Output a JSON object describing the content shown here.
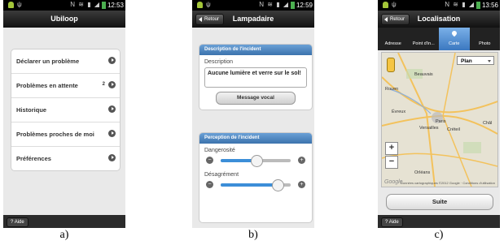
{
  "screen_a": {
    "status_time": "12:53",
    "title": "Ubiloop",
    "menu": [
      {
        "label": "Déclarer un problème",
        "count": ""
      },
      {
        "label": "Problèmes en attente",
        "count": "2"
      },
      {
        "label": "Historique",
        "count": ""
      },
      {
        "label": "Problèmes proches de moi",
        "count": ""
      },
      {
        "label": "Préférences",
        "count": ""
      }
    ],
    "help_label": "Aide",
    "caption": "a)"
  },
  "screen_b": {
    "status_time": "12:59",
    "back_label": "Retour",
    "title": "Lampadaire",
    "section1_header": "Description de l'incident",
    "description_label": "Description",
    "description_value": "Aucune lumière et verre sur le sol!",
    "voice_button": "Message vocal",
    "section2_header": "Perception de l'incident",
    "danger_label": "Dangerosité",
    "danger_level": 0.5,
    "annoyance_label": "Désagrément",
    "annoyance_level": 0.8,
    "caption": "b)"
  },
  "screen_c": {
    "status_time": "13:56",
    "back_label": "Retour",
    "title": "Localisation",
    "tabs": [
      "Adresse",
      "Point d'in...",
      "Carte",
      "Photo"
    ],
    "active_tab": 2,
    "map_type": "Plan",
    "places": [
      "Beauvais",
      "Rouen",
      "Évreux",
      "Paris",
      "Versailles",
      "Créteil",
      "Châl",
      "Orléans"
    ],
    "map_copyright": "Données cartographiques ©2012 Google · Conditions d'utilisation",
    "google_logo": "Google",
    "next_button": "Suite",
    "help_label": "Aide",
    "caption": "c)"
  },
  "colors": {
    "header_blue": "#3c73ad",
    "slider_blue": "#3c8ed8",
    "status_green": "#4caf50"
  },
  "status_icons": [
    "android-icon",
    "usb-icon",
    "signal-icon",
    "wifi-icon",
    "battery-icon"
  ]
}
